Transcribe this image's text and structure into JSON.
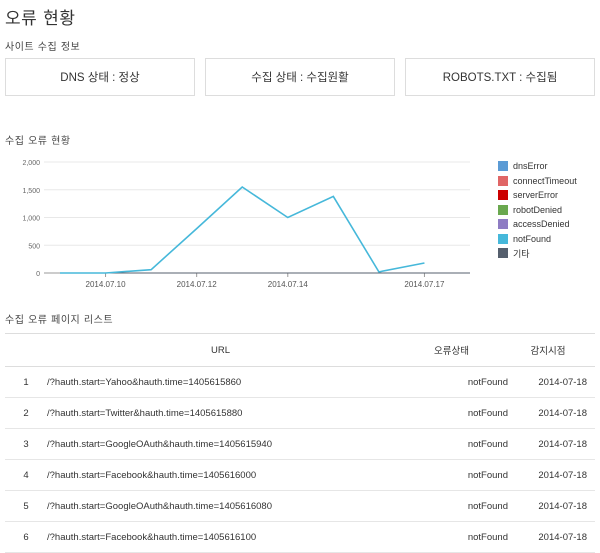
{
  "page": {
    "title": "오류 현황",
    "site_info_label": "사이트 수집 정보",
    "chart_label": "수집 오류 현황",
    "list_label": "수집 오류 페이지 리스트"
  },
  "status_boxes": [
    {
      "text": "DNS 상태 : 정상"
    },
    {
      "text": "수집 상태 : 수집원활"
    },
    {
      "text": "ROBOTS.TXT : 수집됨"
    }
  ],
  "chart_data": {
    "type": "line",
    "x_dates": [
      "2014-07-09",
      "2014-07-10",
      "2014-07-11",
      "2014-07-12",
      "2014-07-13",
      "2014-07-14",
      "2014-07-15",
      "2014-07-16",
      "2014-07-17",
      "2014-07-18"
    ],
    "x_tick_labels": [
      {
        "label": "2014.07.10",
        "date": "2014-07-10"
      },
      {
        "label": "2014.07.12",
        "date": "2014-07-12"
      },
      {
        "label": "2014.07.14",
        "date": "2014-07-14"
      },
      {
        "label": "2014.07.17",
        "date": "2014-07-17"
      }
    ],
    "y_ticks": [
      "2,000",
      "1,500",
      "1,000",
      "500",
      "0"
    ],
    "y_tick_values": [
      2000,
      1500,
      1000,
      500,
      0
    ],
    "ylim": [
      0,
      2000
    ],
    "grid": true,
    "legend_position": "right",
    "series": [
      {
        "name": "dnsError",
        "color": "#5b9bd5",
        "values": [
          0,
          0,
          0,
          0,
          0,
          0,
          0,
          0,
          0,
          0
        ]
      },
      {
        "name": "connectTimeout",
        "color": "#e06666",
        "values": [
          0,
          0,
          0,
          0,
          0,
          0,
          0,
          0,
          0,
          0
        ]
      },
      {
        "name": "serverError",
        "color": "#cc0000",
        "values": [
          0,
          0,
          0,
          0,
          0,
          0,
          0,
          0,
          0,
          0
        ]
      },
      {
        "name": "robotDenied",
        "color": "#6aa84f",
        "values": [
          0,
          0,
          0,
          0,
          0,
          0,
          0,
          0,
          0,
          0
        ]
      },
      {
        "name": "accessDenied",
        "color": "#8e7cc3",
        "values": [
          0,
          0,
          0,
          0,
          0,
          0,
          0,
          0,
          0,
          0
        ]
      },
      {
        "name": "notFound",
        "color": "#46b8da",
        "values": [
          0,
          0,
          60,
          800,
          1550,
          1000,
          1380,
          20,
          180,
          null
        ]
      },
      {
        "name": "기타",
        "color": "#555f6d",
        "values": [
          0,
          0,
          0,
          0,
          0,
          0,
          0,
          0,
          0,
          0
        ]
      }
    ]
  },
  "table": {
    "headers": {
      "num": "",
      "url": "URL",
      "status": "오류상태",
      "date": "감지시점"
    },
    "rows": [
      {
        "num": "1",
        "url": "/?hauth.start=Yahoo&hauth.time=1405615860",
        "status": "notFound",
        "date": "2014-07-18"
      },
      {
        "num": "2",
        "url": "/?hauth.start=Twitter&hauth.time=1405615880",
        "status": "notFound",
        "date": "2014-07-18"
      },
      {
        "num": "3",
        "url": "/?hauth.start=GoogleOAuth&hauth.time=1405615940",
        "status": "notFound",
        "date": "2014-07-18"
      },
      {
        "num": "4",
        "url": "/?hauth.start=Facebook&hauth.time=1405616000",
        "status": "notFound",
        "date": "2014-07-18"
      },
      {
        "num": "5",
        "url": "/?hauth.start=GoogleOAuth&hauth.time=1405616080",
        "status": "notFound",
        "date": "2014-07-18"
      },
      {
        "num": "6",
        "url": "/?hauth.start=Facebook&hauth.time=1405616100",
        "status": "notFound",
        "date": "2014-07-18"
      }
    ]
  }
}
